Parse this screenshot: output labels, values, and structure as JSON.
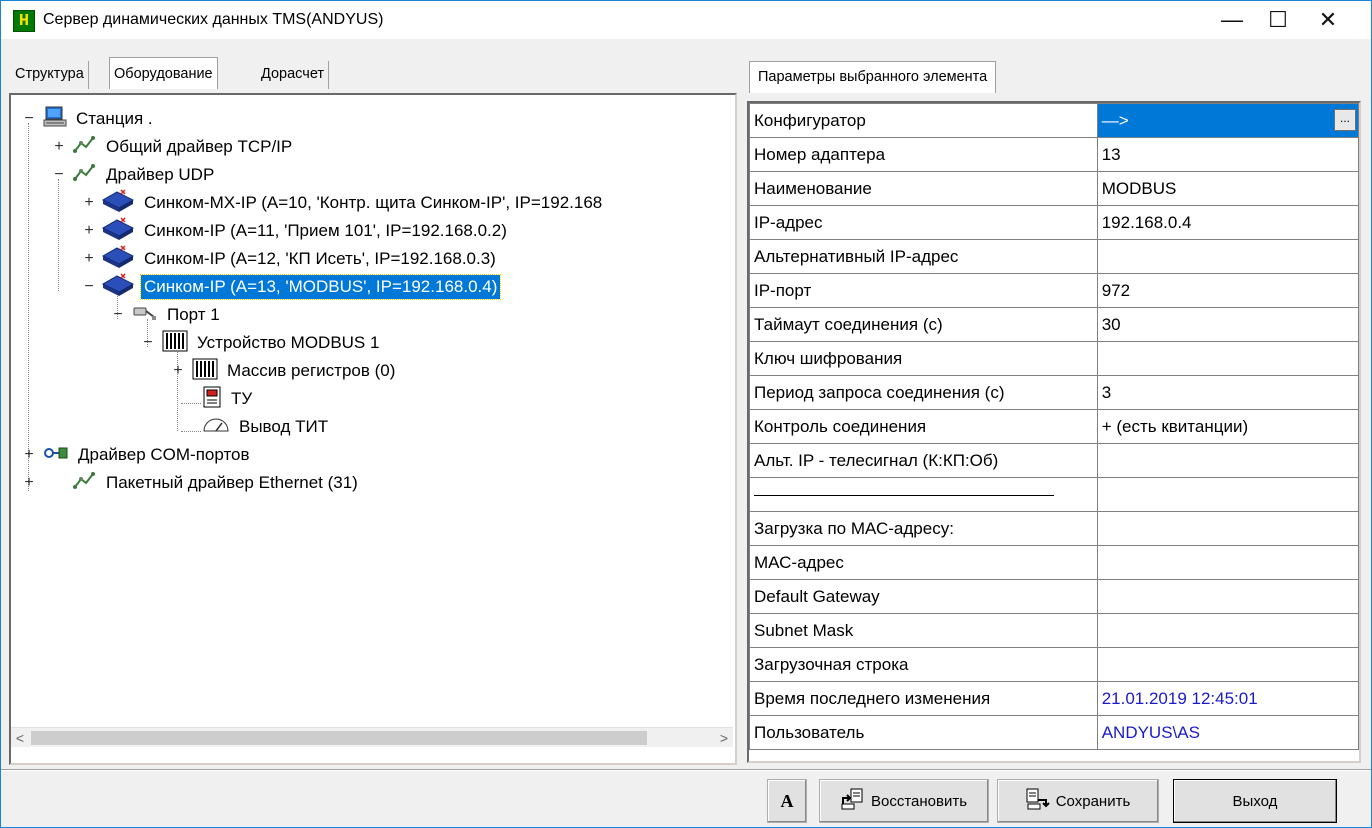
{
  "window": {
    "icon_glyph": "H",
    "title": "Сервер динамических данных TMS(ANDYUS)",
    "minimize_glyph": "—",
    "maximize_glyph": "☐",
    "close_glyph": "✕"
  },
  "left_tabs": [
    {
      "label": "Структура"
    },
    {
      "label": "Оборудование"
    },
    {
      "label": "Дорасчет"
    }
  ],
  "tree": {
    "station": "Станция .",
    "tcp_driver": "Общий драйвер TCP/IP",
    "udp_driver": "Драйвер UDP",
    "sincom_mx": "Синком-МХ-IP  (A=10, 'Контр. щита Синком-IP', IP=192.168",
    "sincom_11": "Синком-IP  (A=11, 'Прием 101', IP=192.168.0.2)",
    "sincom_12": "Синком-IP  (A=12, 'КП Исеть', IP=192.168.0.3)",
    "sincom_13": "Синком-IP  (A=13, 'MODBUS', IP=192.168.0.4)",
    "port1": "Порт 1",
    "modbus_device": "Устройство MODBUS  1",
    "register_array": "Массив регистров  (0)",
    "tu": "ТУ",
    "tit_output": "Вывод ТИТ",
    "com_driver": "Драйвер COM-портов",
    "ethernet_driver": "Пакетный драйвер Ethernet  (31)"
  },
  "right_tab": {
    "label": "Параметры выбранного элемента"
  },
  "properties": [
    {
      "name": "Конфигуратор",
      "value": "—>"
    },
    {
      "name": "Номер адаптера",
      "value": "13"
    },
    {
      "name": "Наименование",
      "value": "MODBUS"
    },
    {
      "name": "IP-адрес",
      "value": "192.168.0.4"
    },
    {
      "name": "Альтернативный IP-адрес",
      "value": ""
    },
    {
      "name": "IP-порт",
      "value": "972"
    },
    {
      "name": "Таймаут соединения (с)",
      "value": "30"
    },
    {
      "name": "Ключ шифрования",
      "value": ""
    },
    {
      "name": "Период запроса соединения (с)",
      "value": "3"
    },
    {
      "name": "Контроль соединения",
      "value": "+ (есть квитанции)"
    },
    {
      "name": "Альт. IP - телесигнал (К:КП:Об)",
      "value": ""
    },
    {
      "name": "",
      "value": ""
    },
    {
      "name": "Загрузка по МАС-адресу:",
      "value": ""
    },
    {
      "name": "МАС-адрес",
      "value": ""
    },
    {
      "name": "Default Gateway",
      "value": ""
    },
    {
      "name": "Subnet Mask",
      "value": ""
    },
    {
      "name": "Загрузочная строка",
      "value": ""
    },
    {
      "name": "Время последнего изменения",
      "value": "21.01.2019 12:45:01"
    },
    {
      "name": "Пользователь",
      "value": "ANDYUS\\AS"
    }
  ],
  "ellipsis_label": "...",
  "buttons": {
    "font": "A",
    "restore": "Восстановить",
    "save": "Сохранить",
    "exit": "Выход"
  },
  "colors": {
    "selection": "#0078d7",
    "link_value": "#1a1acc"
  }
}
